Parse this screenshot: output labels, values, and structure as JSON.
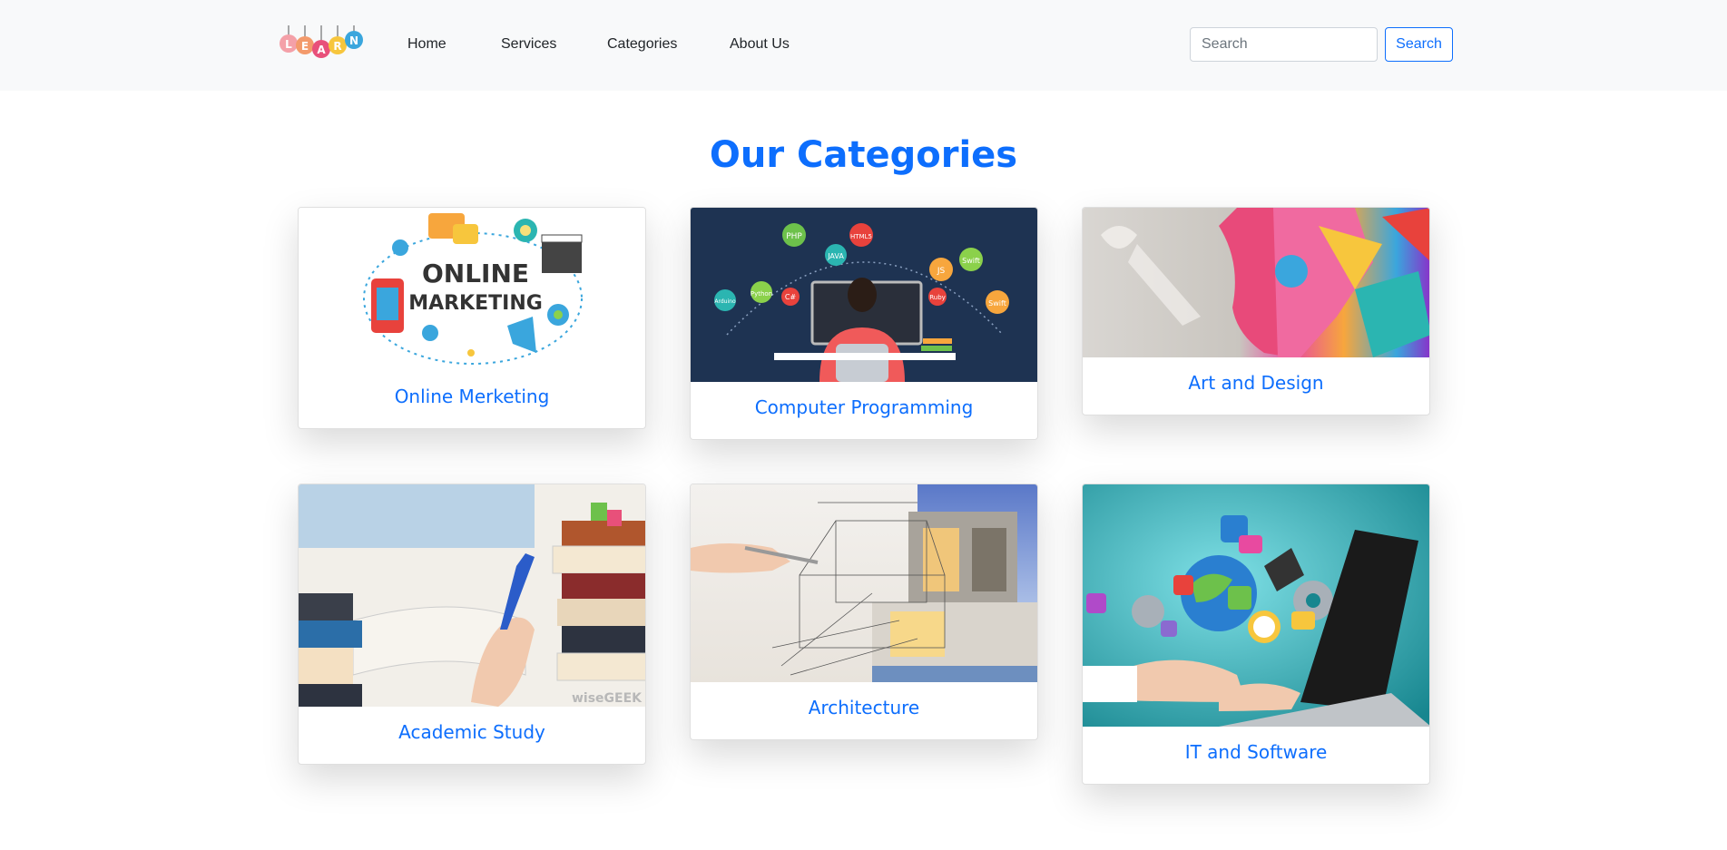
{
  "navbar": {
    "logo_letters": [
      "L",
      "E",
      "A",
      "R",
      "N"
    ],
    "links": [
      "Home",
      "Services",
      "Categories",
      "About Us"
    ],
    "search_placeholder": "Search",
    "search_button": "Search"
  },
  "main": {
    "heading": "Our Categories",
    "marketing_image_text": [
      "ONLINE",
      "MARKETING"
    ],
    "programming_bubbles": [
      "PHP",
      "HTML5",
      "JAVA",
      "Python",
      "C#",
      "JS",
      "Swift",
      "Ruby",
      "Arduino",
      "Swift"
    ],
    "study_watermark": "wiseGEEK",
    "cards": [
      {
        "title": "Online Merketing"
      },
      {
        "title": "Computer Programming"
      },
      {
        "title": "Art and Design"
      },
      {
        "title": "Academic Study"
      },
      {
        "title": "Architecture"
      },
      {
        "title": "IT and Software"
      }
    ]
  },
  "colors": {
    "accent": "#0d6efd",
    "navbar_bg": "#f8f9fa"
  }
}
